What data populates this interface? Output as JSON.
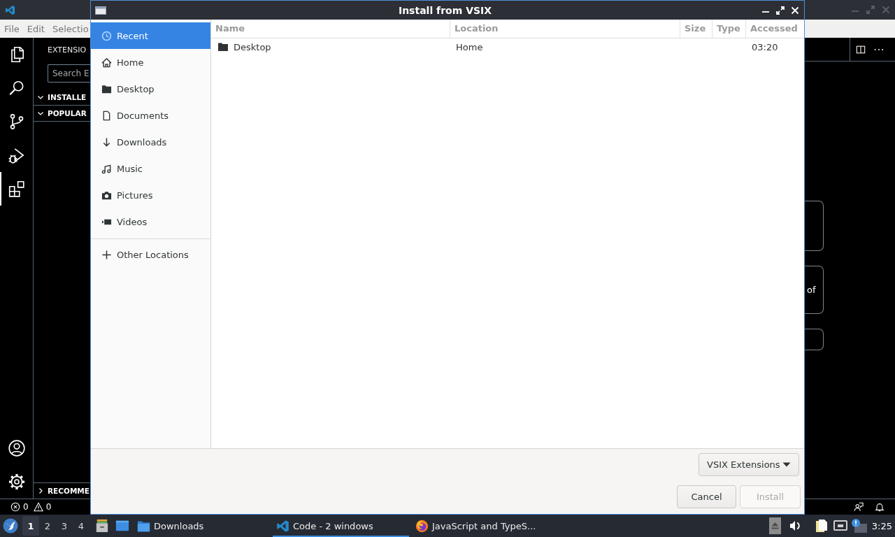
{
  "vscode": {
    "menu": [
      {
        "label": "File"
      },
      {
        "label": "Edit"
      },
      {
        "label": "Selectio"
      }
    ],
    "activity_bar": [
      {
        "kind": "files",
        "selected": false
      },
      {
        "kind": "search",
        "selected": false
      },
      {
        "kind": "source-control",
        "selected": false
      },
      {
        "kind": "run-debug",
        "selected": false
      },
      {
        "kind": "extensions",
        "selected": true
      }
    ],
    "activity_bottom": [
      {
        "kind": "account"
      },
      {
        "kind": "settings"
      }
    ],
    "sidebar": {
      "title": "EXTENSIO",
      "search": {
        "placeholder": "Search E"
      },
      "sections": [
        {
          "label": "INSTALLE",
          "expanded": true
        },
        {
          "label": "POPULAR",
          "expanded": true
        },
        {
          "label": "RECOMME",
          "expanded": false
        }
      ]
    },
    "editor": {
      "actions": [
        {
          "kind": "split"
        },
        {
          "kind": "more"
        }
      ],
      "cards": [
        {
          "kind": "tile"
        },
        {
          "kind": "text",
          "text": "of"
        },
        {
          "kind": "bar"
        }
      ]
    },
    "status_bar": {
      "errors": "0",
      "warnings": "0",
      "actions": [
        {
          "kind": "feedback"
        },
        {
          "kind": "bell"
        }
      ]
    }
  },
  "dialog": {
    "title": "Install from VSIX",
    "places": [
      {
        "kind": "recent",
        "label": "Recent",
        "selected": true
      },
      {
        "kind": "home",
        "label": "Home",
        "selected": false
      },
      {
        "kind": "desktop",
        "label": "Desktop",
        "selected": false
      },
      {
        "kind": "documents",
        "label": "Documents",
        "selected": false
      },
      {
        "kind": "downloads",
        "label": "Downloads",
        "selected": false
      },
      {
        "kind": "music",
        "label": "Music",
        "selected": false
      },
      {
        "kind": "pictures",
        "label": "Pictures",
        "selected": false
      },
      {
        "kind": "videos",
        "label": "Videos",
        "selected": false
      }
    ],
    "other_places": [
      {
        "kind": "other",
        "label": "Other Locations",
        "selected": false
      }
    ],
    "columns": [
      "Name",
      "Location",
      "Size",
      "Type",
      "Accessed"
    ],
    "rows": [
      {
        "name": "Desktop",
        "location": "Home",
        "accessed": "03:20"
      }
    ],
    "filter": "VSIX Extensions",
    "buttons": [
      {
        "label": "Cancel",
        "disabled": false
      },
      {
        "label": "Install",
        "disabled": true
      }
    ]
  },
  "taskbar": {
    "workspaces": [
      {
        "label": "1",
        "selected": true
      },
      {
        "label": "2",
        "selected": false
      },
      {
        "label": "3",
        "selected": false
      },
      {
        "label": "4",
        "selected": false
      }
    ],
    "launchers": [
      {
        "kind": "file-cabinet"
      },
      {
        "kind": "window"
      }
    ],
    "tasks": [
      {
        "kind": "folder",
        "label": "Downloads",
        "selected": false
      },
      {
        "kind": "code",
        "label": "Code - 2 windows",
        "selected": true
      },
      {
        "kind": "browser",
        "label": "JavaScript and TypeS...",
        "selected": false
      }
    ],
    "tray": [
      {
        "kind": "eject"
      },
      {
        "kind": "volume"
      },
      {
        "kind": "clipboard"
      },
      {
        "kind": "network"
      },
      {
        "kind": "update"
      }
    ],
    "clock": "3:25"
  }
}
